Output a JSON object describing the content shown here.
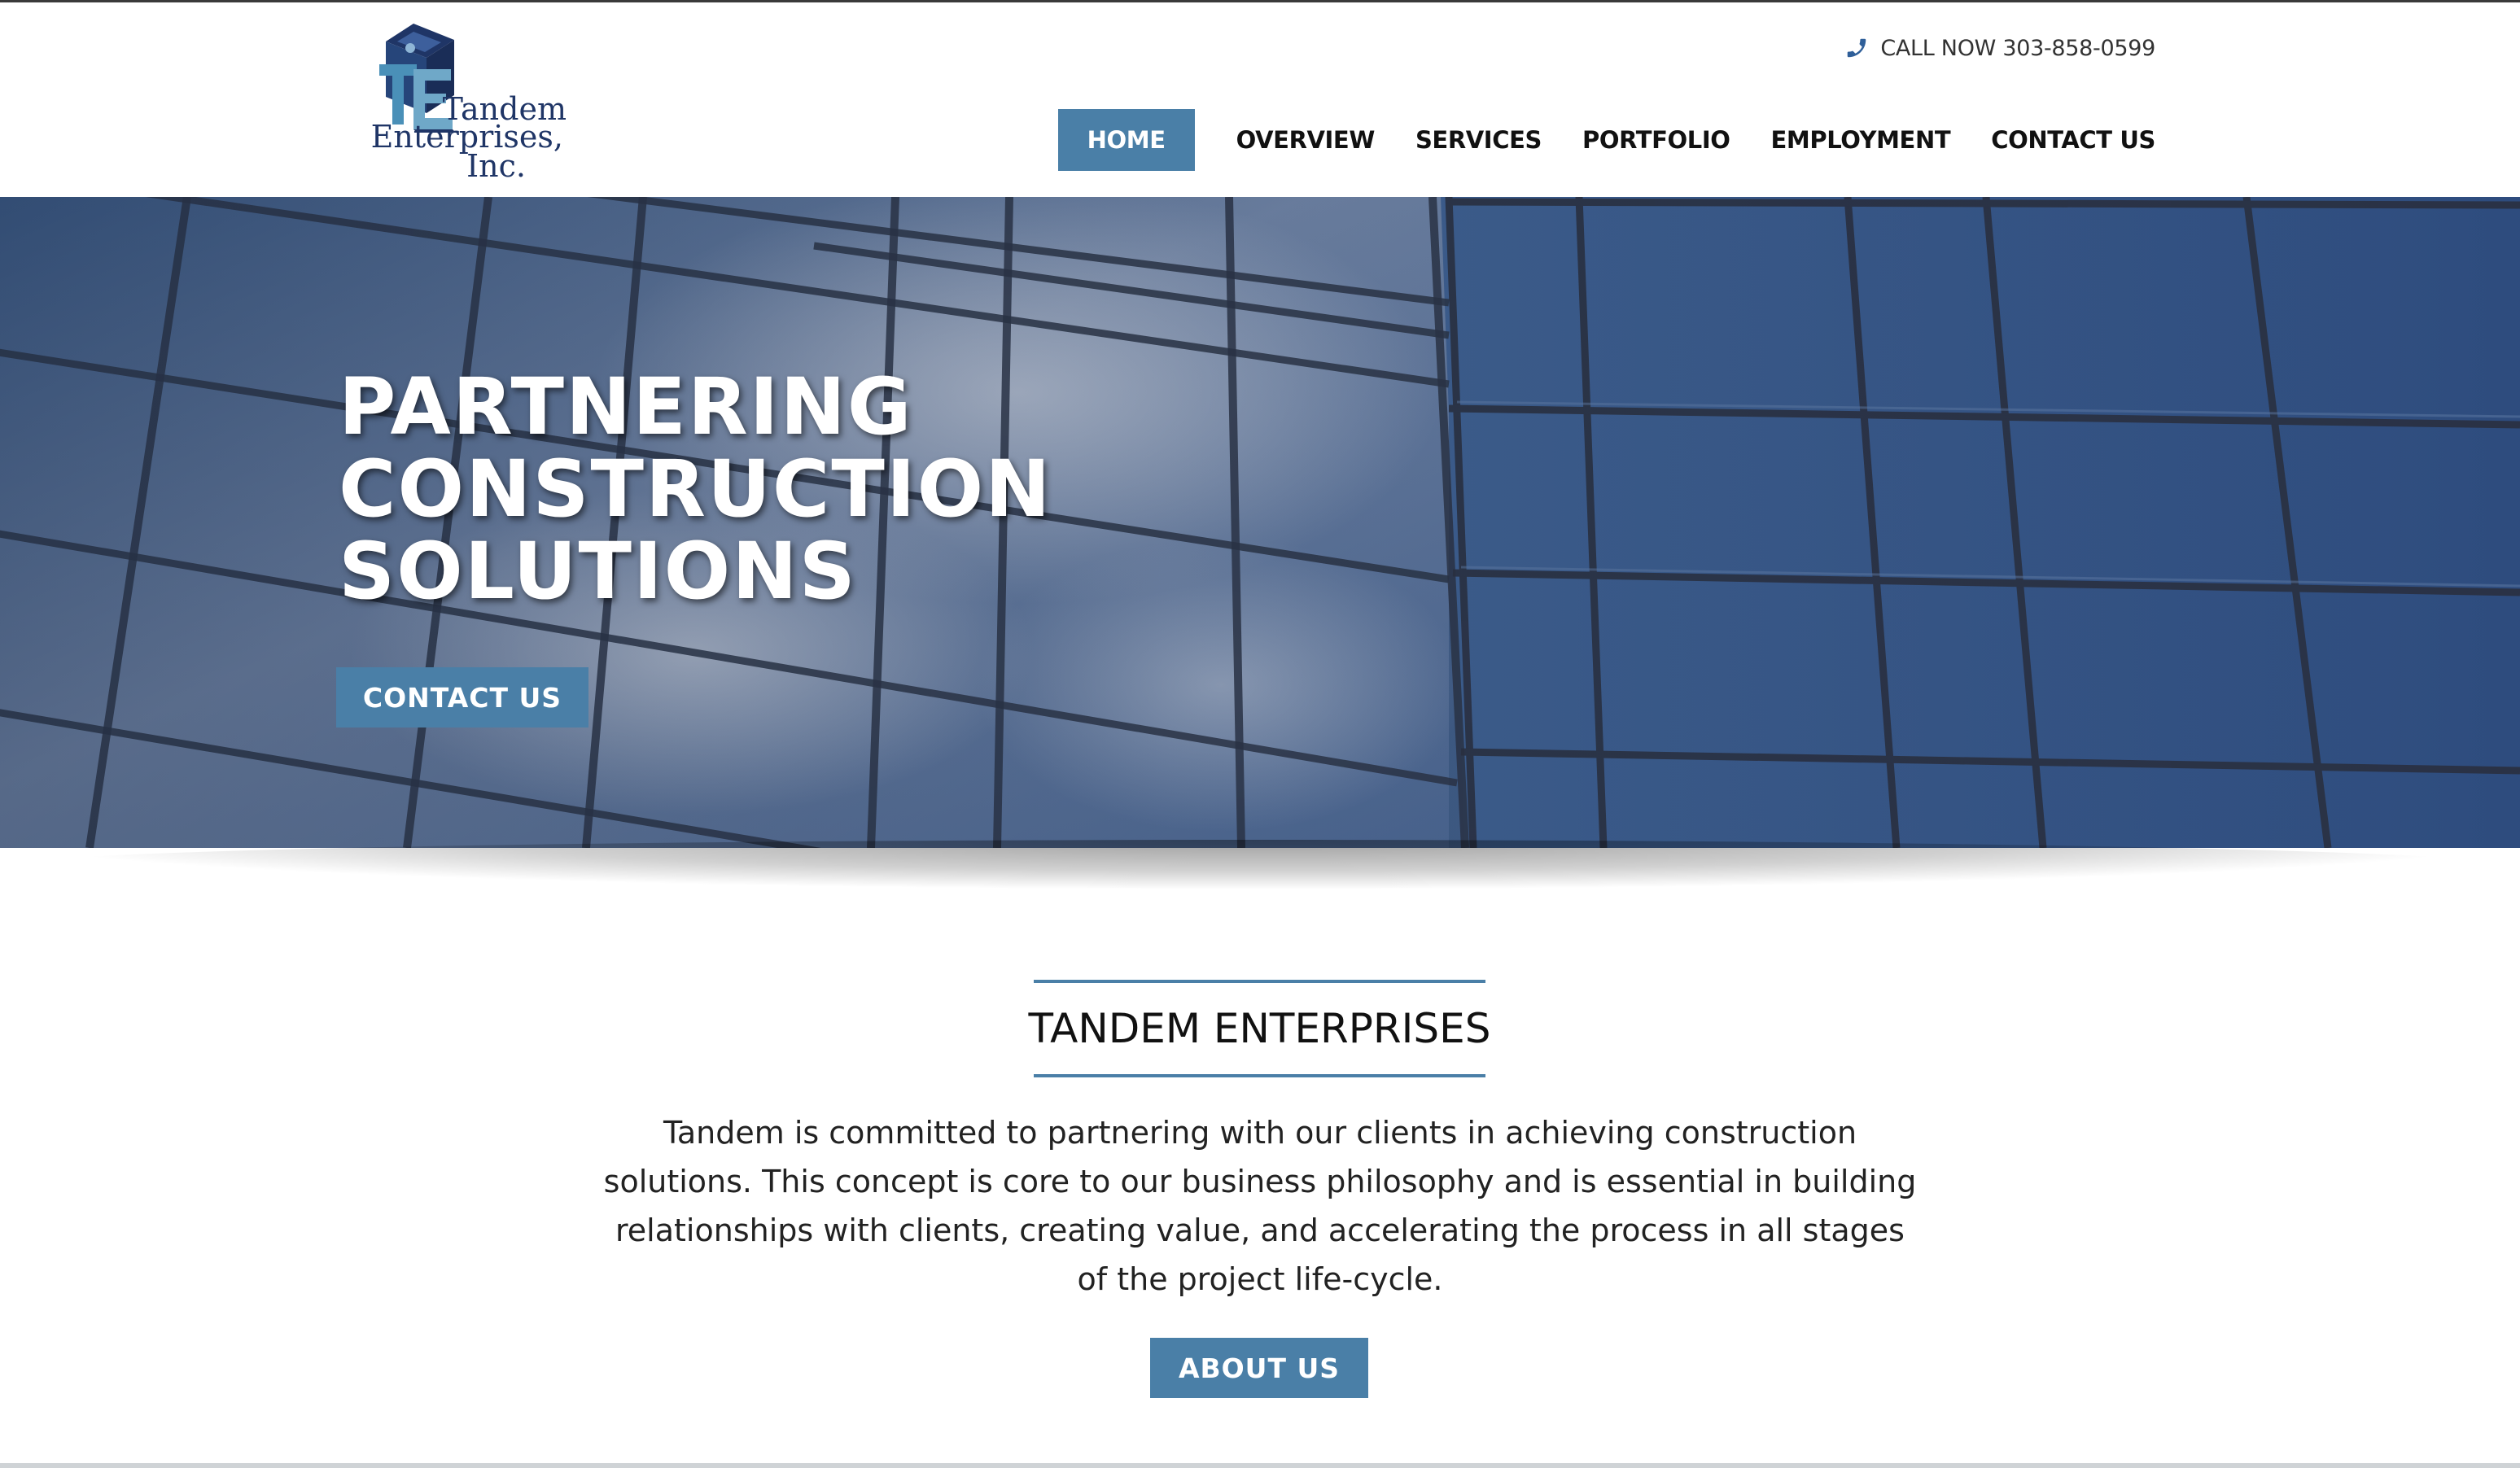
{
  "brand": {
    "name_line1": "Tandem",
    "name_line2": "Enterprises,",
    "name_line3": "Inc.",
    "logo_icon": "te-cube-logo",
    "primary_color": "#4a7fa7"
  },
  "header": {
    "phone_icon": "phone-icon",
    "phone_text": "CALL NOW 303-858-0599"
  },
  "nav": {
    "items": [
      {
        "label": "HOME",
        "active": true
      },
      {
        "label": "OVERVIEW",
        "active": false
      },
      {
        "label": "SERVICES",
        "active": false
      },
      {
        "label": "PORTFOLIO",
        "active": false
      },
      {
        "label": "EMPLOYMENT",
        "active": false
      },
      {
        "label": "CONTACT US",
        "active": false
      }
    ]
  },
  "hero": {
    "title_lines": [
      "PARTNERING",
      "CONSTRUCTION",
      "SOLUTIONS"
    ],
    "cta_label": "CONTACT US",
    "background": "glass-building-facade"
  },
  "intro": {
    "heading": "TANDEM ENTERPRISES",
    "body": "Tandem is committed to partnering with our clients in achieving construction solutions. This concept is core to our business philosophy and is essential in building relationships with clients, creating value, and accelerating the process in all stages of the project life-cycle.",
    "button_label": "ABOUT US"
  }
}
